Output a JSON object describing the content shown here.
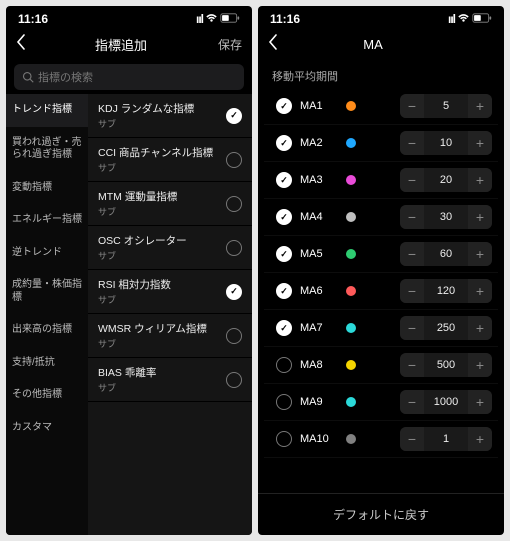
{
  "status": {
    "time": "11:16"
  },
  "left": {
    "nav": {
      "title": "指標追加",
      "save": "保存"
    },
    "search_placeholder": "指標の検索",
    "sidebar": {
      "items": [
        "トレンド指標",
        "買われ過ぎ・売られ過ぎ指標",
        "変動指標",
        "エネルギー指標",
        "逆トレンド",
        "成約量・株価指標",
        "出来高の指標",
        "支持/抵抗",
        "その他指標",
        "カスタマ"
      ],
      "active_index": 0
    },
    "list": [
      {
        "main": "KDJ ランダムな指標",
        "sub": "サブ",
        "checked": true
      },
      {
        "main": "CCI 商品チャンネル指標",
        "sub": "サブ",
        "checked": false
      },
      {
        "main": "MTM 運動量指標",
        "sub": "サブ",
        "checked": false
      },
      {
        "main": "OSC オシレーター",
        "sub": "サブ",
        "checked": false
      },
      {
        "main": "RSI 相対力指数",
        "sub": "サブ",
        "checked": true
      },
      {
        "main": "WMSR ウィリアム指標",
        "sub": "サブ",
        "checked": false
      },
      {
        "main": "BIAS 乖離率",
        "sub": "サブ",
        "checked": false
      }
    ]
  },
  "right": {
    "nav": {
      "title": "MA"
    },
    "section_label": "移動平均期間",
    "rows": [
      {
        "label": "MA1",
        "color": "#ff8c1a",
        "value": "5",
        "checked": true
      },
      {
        "label": "MA2",
        "color": "#1fa8ff",
        "value": "10",
        "checked": true
      },
      {
        "label": "MA3",
        "color": "#e94bd8",
        "value": "20",
        "checked": true
      },
      {
        "label": "MA4",
        "color": "#bfbfbf",
        "value": "30",
        "checked": true
      },
      {
        "label": "MA5",
        "color": "#2ecc71",
        "value": "60",
        "checked": true
      },
      {
        "label": "MA6",
        "color": "#ff5a5a",
        "value": "120",
        "checked": true
      },
      {
        "label": "MA7",
        "color": "#2bd9d9",
        "value": "250",
        "checked": true
      },
      {
        "label": "MA8",
        "color": "#f5d500",
        "value": "500",
        "checked": false
      },
      {
        "label": "MA9",
        "color": "#2bd9d9",
        "value": "1000",
        "checked": false
      },
      {
        "label": "MA10",
        "color": "#808080",
        "value": "1",
        "checked": false
      }
    ],
    "reset_label": "デフォルトに戻す"
  }
}
